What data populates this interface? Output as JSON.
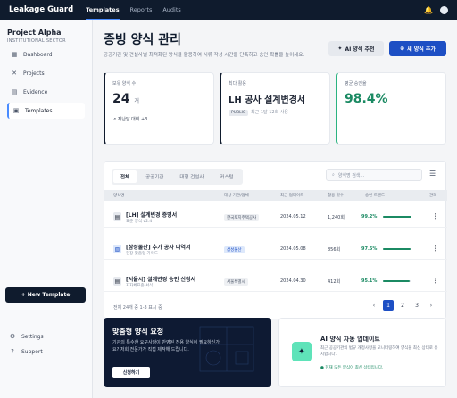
{
  "topbar": {
    "brand": "Leakage Guard",
    "nav": [
      "Templates",
      "Reports",
      "Audits"
    ]
  },
  "sidebar": {
    "project_name": "Project Alpha",
    "project_sector": "INSTITUTIONAL SECTOR",
    "items": [
      {
        "label": "Dashboard",
        "icon": "grid-icon"
      },
      {
        "label": "Projects",
        "icon": "tools-icon"
      },
      {
        "label": "Evidence",
        "icon": "document-icon"
      },
      {
        "label": "Templates",
        "icon": "template-icon"
      }
    ],
    "new_template": "+ New Template",
    "settings": "Settings",
    "support": "Support"
  },
  "header": {
    "title": "증빙 양식 관리",
    "description": "공공기관 및 건설사별 최적화된 양식을 활용하여 서류 작성 시간을 단축하고 승인 확률을 높이세요.",
    "ai_button": "AI 양식 추천",
    "add_button": "새 양식 추가"
  },
  "stats": [
    {
      "label": "보유 양식 수",
      "value": "24",
      "unit": "개",
      "sub": "지난달 대비 +3"
    },
    {
      "label": "최다 활용",
      "value": "LH 공사 설계변경서",
      "badge": "PUBLIC",
      "sub": "최근 1달 12회 사용"
    },
    {
      "label": "평균 승인율",
      "value": "98.4%"
    }
  ],
  "table": {
    "tabs": [
      "전체",
      "공공기관",
      "대형 건설사",
      "커스텀"
    ],
    "search_placeholder": "양식명 검색...",
    "columns": [
      "양식명",
      "대상 기관/업체",
      "최근 업데이트",
      "활용 횟수",
      "승인 트렌드",
      "관리"
    ],
    "rows": [
      {
        "title": "[LH] 설계변경 증명서",
        "subtitle": "표준 양식 v2.4",
        "org": "한국토지주택공사",
        "date": "2024.05.12",
        "count": "1,240회",
        "rate": "99.2%",
        "rate_value": 0.992
      },
      {
        "title": "[삼성물산] 추가 공사 내역서",
        "subtitle": "현장 맞춤형 가이드",
        "org": "삼성물산",
        "date": "2024.05.08",
        "count": "856회",
        "rate": "97.5%",
        "rate_value": 0.975
      },
      {
        "title": "[서울시] 설계변경 승인 신청서",
        "subtitle": "지자체표준 서식",
        "org": "서울특별시",
        "date": "2024.04.30",
        "count": "412회",
        "rate": "95.1%",
        "rate_value": 0.951
      }
    ],
    "footer": "전체 24개 중 1-3 표시 중",
    "pages": [
      "1",
      "2",
      "3"
    ]
  },
  "promo": {
    "title": "맞춤형 양식 요청",
    "text": "기관의 특수한 요구사항이 반영된 전용 양식이 필요하신가요? 저희 전문가가 직접 제작해 드립니다.",
    "cta": "신청하기"
  },
  "update": {
    "title": "AI 양식 자동 업데이트",
    "text": "최근 공공기관의 법규 개정사항을 모니터링하여 양식을 최신 상태로 유지합니다.",
    "status": "현재 모든 양식이 최신 상태입니다."
  }
}
